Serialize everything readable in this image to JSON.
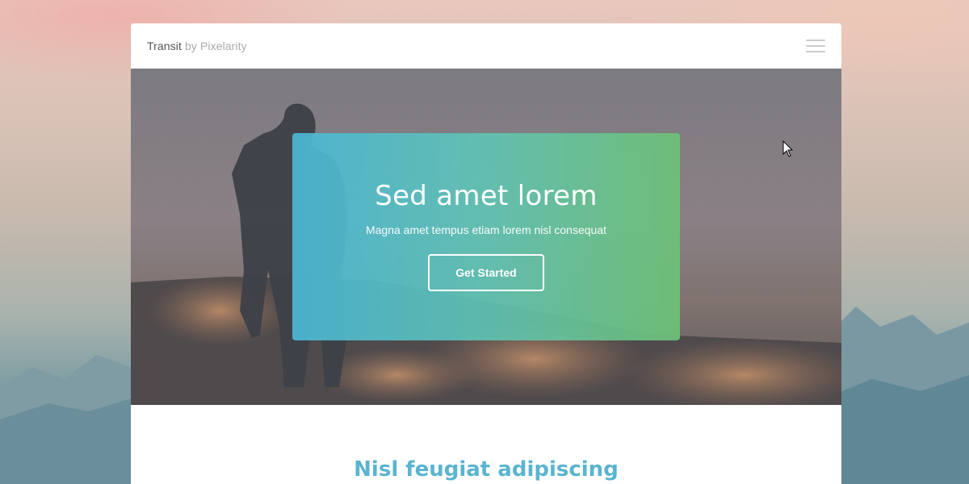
{
  "navbar": {
    "brand_name": "Transit",
    "brand_by": "by Pixelarity",
    "menu_icon": "hamburger-menu-icon"
  },
  "hero": {
    "title": "Sed amet lorem",
    "subtitle": "Magna amet tempus etiam lorem nisl consequat",
    "button_label": "Get Started",
    "gradient_start": "#4bb8d6",
    "gradient_end": "#6ec278"
  },
  "section": {
    "title": "Nisl feugiat adipiscing",
    "title_color": "#5ab4cf"
  }
}
